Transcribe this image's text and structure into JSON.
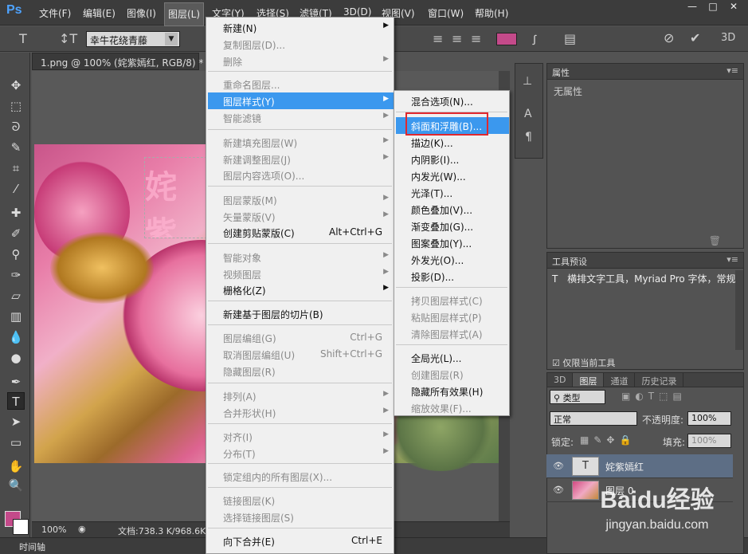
{
  "app": {
    "logo": "Ps"
  },
  "menubar": {
    "items": [
      "文件(F)",
      "编辑(E)",
      "图像(I)",
      "图层(L)",
      "文字(Y)",
      "选择(S)",
      "滤镜(T)",
      "3D(D)",
      "视图(V)",
      "窗口(W)",
      "帮助(H)"
    ],
    "window_buttons": [
      "—",
      "□",
      "✕"
    ]
  },
  "options": {
    "font_family": "幸牛花绕青藤",
    "color": "#c44a8a"
  },
  "document": {
    "tab_title": "1.png @ 100% (姹紫嫣红, RGB/8) *",
    "text_layer_preview": "姹紫",
    "zoom": "100%",
    "doc_info": "文档:738.3 K/968.6K"
  },
  "timeline_label": "时间轴",
  "layer_menu": {
    "items": [
      {
        "label": "新建(N)",
        "arrow": true,
        "disabled": false
      },
      {
        "label": "复制图层(D)...",
        "disabled": true
      },
      {
        "label": "删除",
        "arrow": true,
        "disabled": true
      },
      {
        "label": "重命名图层...",
        "disabled": true
      },
      {
        "label": "图层样式(Y)",
        "arrow": true,
        "highlight": true
      },
      {
        "label": "智能滤镜",
        "arrow": true,
        "disabled": true
      },
      {
        "label": "新建填充图层(W)",
        "arrow": true,
        "disabled": true
      },
      {
        "label": "新建调整图层(J)",
        "arrow": true,
        "disabled": true
      },
      {
        "label": "图层内容选项(O)...",
        "disabled": true
      },
      {
        "label": "图层蒙版(M)",
        "arrow": true,
        "disabled": true
      },
      {
        "label": "矢量蒙版(V)",
        "arrow": true,
        "disabled": true
      },
      {
        "label": "创建剪贴蒙版(C)",
        "shortcut": "Alt+Ctrl+G"
      },
      {
        "label": "智能对象",
        "arrow": true,
        "disabled": true
      },
      {
        "label": "视频图层",
        "arrow": true,
        "disabled": true
      },
      {
        "label": "栅格化(Z)",
        "arrow": true
      },
      {
        "label": "新建基于图层的切片(B)"
      },
      {
        "label": "图层编组(G)",
        "shortcut": "Ctrl+G",
        "disabled": true
      },
      {
        "label": "取消图层编组(U)",
        "shortcut": "Shift+Ctrl+G",
        "disabled": true
      },
      {
        "label": "隐藏图层(R)",
        "disabled": true
      },
      {
        "label": "排列(A)",
        "arrow": true,
        "disabled": true
      },
      {
        "label": "合并形状(H)",
        "arrow": true,
        "disabled": true
      },
      {
        "label": "对齐(I)",
        "arrow": true,
        "disabled": true
      },
      {
        "label": "分布(T)",
        "arrow": true,
        "disabled": true
      },
      {
        "label": "锁定组内的所有图层(X)...",
        "disabled": true
      },
      {
        "label": "链接图层(K)",
        "disabled": true
      },
      {
        "label": "选择链接图层(S)",
        "disabled": true
      },
      {
        "label": "向下合并(E)",
        "shortcut": "Ctrl+E"
      }
    ]
  },
  "style_menu": {
    "items": [
      {
        "label": "混合选项(N)..."
      },
      {
        "label": "斜面和浮雕(B)...",
        "highlight": true
      },
      {
        "label": "描边(K)..."
      },
      {
        "label": "内阴影(I)..."
      },
      {
        "label": "内发光(W)..."
      },
      {
        "label": "光泽(T)..."
      },
      {
        "label": "颜色叠加(V)..."
      },
      {
        "label": "渐变叠加(G)..."
      },
      {
        "label": "图案叠加(Y)..."
      },
      {
        "label": "外发光(O)..."
      },
      {
        "label": "投影(D)..."
      },
      {
        "label": "拷贝图层样式(C)",
        "disabled": true
      },
      {
        "label": "粘贴图层样式(P)",
        "disabled": true
      },
      {
        "label": "清除图层样式(A)",
        "disabled": true
      },
      {
        "label": "全局光(L)..."
      },
      {
        "label": "创建图层(R)",
        "disabled": true
      },
      {
        "label": "隐藏所有效果(H)"
      },
      {
        "label": "缩放效果(F)...",
        "disabled": true
      }
    ]
  },
  "properties_panel": {
    "title": "属性",
    "empty_text": "无属性"
  },
  "tool_presets_panel": {
    "title": "工具预设",
    "preset": "横排文字工具，Myriad Pro 字体，常规",
    "current_only": "仅限当前工具"
  },
  "layers_panel": {
    "tabs": [
      "3D",
      "图层",
      "通道",
      "历史记录"
    ],
    "active_tab": "图层",
    "filter": "类型",
    "blend_mode": "正常",
    "opacity_label": "不透明度:",
    "opacity": "100%",
    "lock_label": "锁定:",
    "fill_label": "填充:",
    "fill": "100%",
    "layers": [
      {
        "name": "姹紫嫣红",
        "type": "text",
        "selected": true
      },
      {
        "name": "图层 0",
        "type": "image",
        "selected": false
      }
    ]
  },
  "watermark": {
    "brand": "Baidu经验",
    "url": "jingyan.baidu.com"
  }
}
